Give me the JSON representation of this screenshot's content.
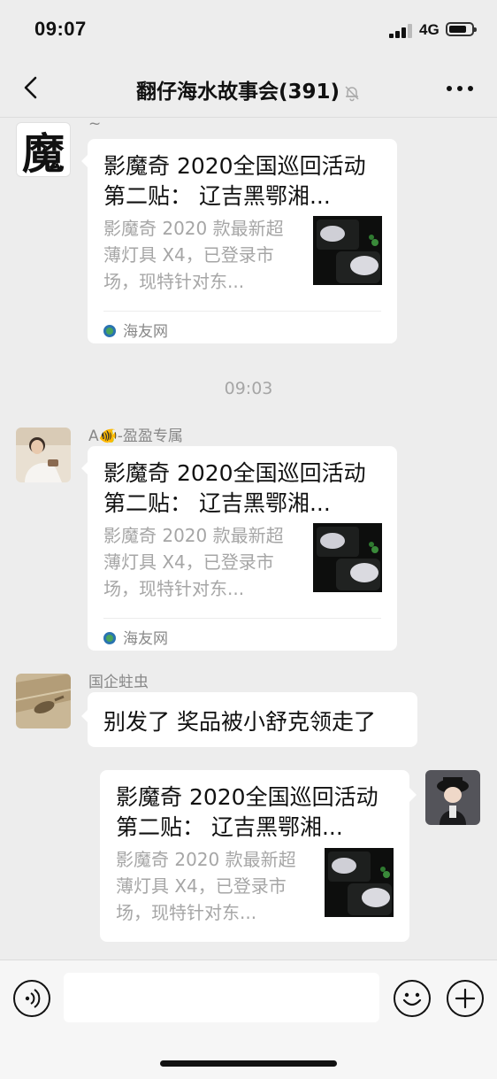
{
  "status_bar": {
    "time": "09:07",
    "network": "4G"
  },
  "header": {
    "title": "翻仔海水故事会(391)"
  },
  "messages": [
    {
      "sender": "~",
      "side": "left",
      "type": "link_card",
      "title": "影魔奇 2020全国巡回活动第二贴： 辽吉黑鄂湘...",
      "description": "影魔奇 2020 款最新超薄灯具 X4，已登录市场，现特针对东...",
      "source": "海友网"
    },
    {
      "type": "timestamp",
      "text": "09:03"
    },
    {
      "sender": "A🐠-盈盈专属",
      "side": "left",
      "type": "link_card",
      "title": "影魔奇 2020全国巡回活动第二贴： 辽吉黑鄂湘...",
      "description": "影魔奇 2020 款最新超薄灯具 X4，已登录市场，现特针对东...",
      "source": "海友网"
    },
    {
      "sender": "国企蛀虫",
      "side": "left",
      "type": "text",
      "text": "别发了 奖品被小舒克领走了"
    },
    {
      "side": "right",
      "type": "link_card",
      "title": "影魔奇 2020全国巡回活动第二贴： 辽吉黑鄂湘...",
      "description": "影魔奇 2020 款最新超薄灯具 X4，已登录市场，现特针对东..."
    }
  ],
  "avatar_1_glyph": "魔",
  "input_bar": {
    "placeholder": ""
  },
  "icons": [
    "back-chevron-icon",
    "mute-bell-icon",
    "more-dots-icon",
    "voice-icon",
    "emoji-icon",
    "plus-icon"
  ]
}
